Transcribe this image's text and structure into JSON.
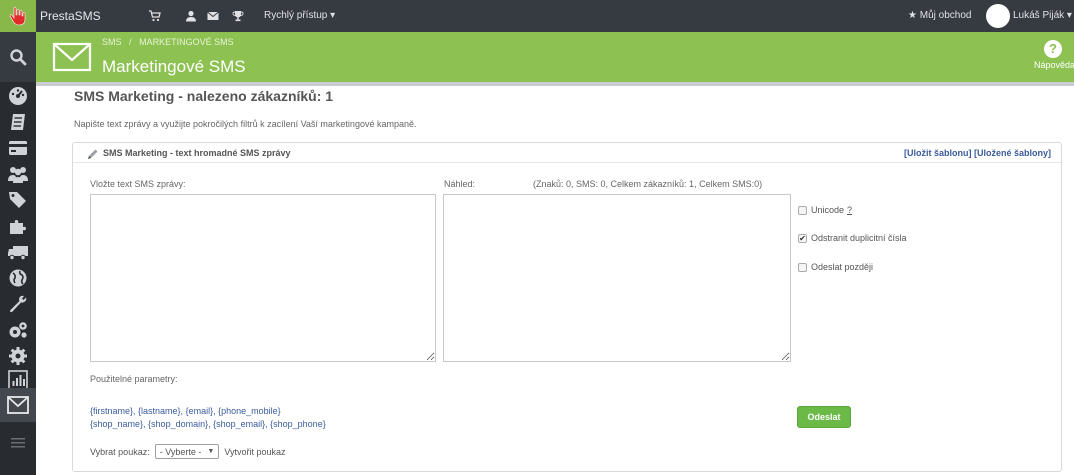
{
  "topbar": {
    "brand": "PrestaSMS",
    "quick_access": "Rychlý přístup",
    "my_shop": "Můj obchod",
    "user_name": "Lukáš Piják"
  },
  "header": {
    "breadcrumb_1": "SMS",
    "breadcrumb_sep": "/",
    "breadcrumb_2": "MARKETINGOVÉ SMS",
    "title": "Marketingové SMS",
    "help_label": "Nápověda"
  },
  "main": {
    "title": "SMS Marketing - nalezeno zákazníků: 1",
    "intro": "Napište text zprávy a využijte pokročilých filtrů k zacílení Vaší marketingové kampaně."
  },
  "panel": {
    "title": "SMS Marketing - text hromadné SMS zprávy",
    "save_template": "[Uložit šablonu]",
    "saved_templates": "[Uložené šablony]",
    "message_label": "Vložte text SMS zprávy:",
    "preview_label": "Náhled:",
    "preview_stats": "(Znaků: 0, SMS: 0, Celkem zákazníků: 1, Celkem SMS:0)",
    "message_value": "",
    "preview_value": "",
    "options": {
      "unicode_label": "Unicode",
      "unicode_help": "?",
      "unicode_checked": false,
      "dedupe_label": "Odstranit duplicitní čísla",
      "dedupe_checked": true,
      "later_label": "Odeslat později",
      "later_checked": false
    },
    "params_label": "Použitelné parametry:",
    "params_line1": "{firstname}, {lastname}, {email}, {phone_mobile}",
    "params_line2": "{shop_name}, {shop_domain}, {shop_email}, {shop_phone}",
    "voucher_label": "Vybrat poukaz:",
    "voucher_selected": "- Vyberte -",
    "voucher_create": "Vytvořit poukaz",
    "send_button": "Odeslat"
  },
  "colors": {
    "topbar": "#363a41",
    "sidebar": "#282b30",
    "header_green": "#8dc252",
    "send_green": "#6bb947",
    "link_blue": "#3a5c9a"
  }
}
